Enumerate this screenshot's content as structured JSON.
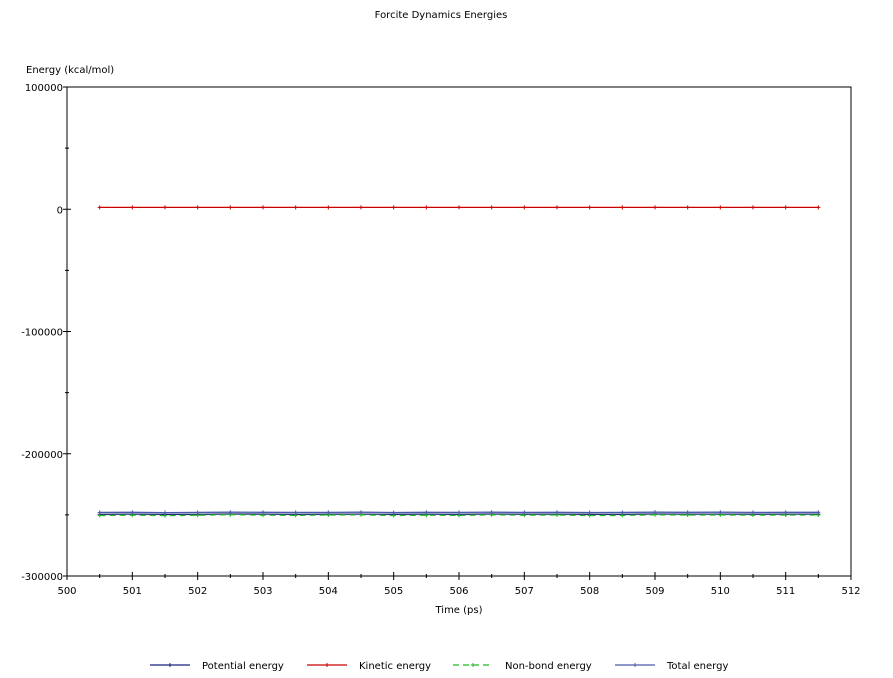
{
  "chart_data": {
    "type": "line",
    "title": "Forcite Dynamics Energies",
    "xlabel": "Time (ps)",
    "ylabel": "Energy (kcal/mol)",
    "xlim": [
      500,
      512
    ],
    "ylim": [
      -300000,
      100000
    ],
    "x_ticks": [
      500,
      501,
      502,
      503,
      504,
      505,
      506,
      507,
      508,
      509,
      510,
      511,
      512
    ],
    "y_ticks": [
      100000,
      0,
      -100000,
      -200000,
      -300000
    ],
    "x_tick_labels": [
      "500",
      "501",
      "502",
      "503",
      "504",
      "505",
      "506",
      "507",
      "508",
      "509",
      "510",
      "511",
      "512"
    ],
    "y_tick_labels": [
      "100000",
      "0",
      "-100000",
      "-200000",
      "-300000"
    ],
    "grid": false,
    "legend_position": "bottom",
    "x": [
      500.5,
      501.0,
      501.5,
      502.0,
      502.5,
      503.0,
      503.5,
      504.0,
      504.5,
      505.0,
      505.5,
      506.0,
      506.5,
      507.0,
      507.5,
      508.0,
      508.5,
      509.0,
      509.5,
      510.0,
      510.5,
      511.0,
      511.5
    ],
    "series": [
      {
        "name": "Potential energy",
        "color": "#1a237e",
        "style": "solid",
        "values": [
          -249500,
          -249400,
          -249600,
          -249500,
          -249300,
          -249400,
          -249500,
          -249450,
          -249350,
          -249550,
          -249400,
          -249500,
          -249300,
          -249450,
          -249400,
          -249550,
          -249500,
          -249300,
          -249400,
          -249350,
          -249450,
          -249400,
          -249400
        ]
      },
      {
        "name": "Kinetic energy",
        "color": "#cc0000",
        "style": "solid",
        "values": [
          1500,
          1500,
          1500,
          1500,
          1500,
          1500,
          1500,
          1500,
          1500,
          1500,
          1500,
          1500,
          1500,
          1500,
          1500,
          1500,
          1500,
          1500,
          1500,
          1500,
          1500,
          1500,
          1500
        ]
      },
      {
        "name": "Non-bond energy",
        "color": "#22bb22",
        "style": "dashed",
        "values": [
          -250500,
          -250200,
          -250600,
          -250300,
          -249800,
          -250200,
          -250400,
          -250100,
          -249900,
          -250500,
          -250300,
          -250400,
          -249900,
          -250200,
          -250100,
          -250500,
          -250400,
          -249900,
          -250100,
          -250000,
          -250200,
          -250100,
          -250100
        ]
      },
      {
        "name": "Total energy",
        "color": "#4a5aa8",
        "style": "solid",
        "values": [
          -248000,
          -247900,
          -248100,
          -248000,
          -247800,
          -247900,
          -248000,
          -247950,
          -247850,
          -248050,
          -247900,
          -248000,
          -247800,
          -247950,
          -247900,
          -248050,
          -248000,
          -247800,
          -247900,
          -247850,
          -247950,
          -247900,
          -247900
        ]
      }
    ]
  }
}
